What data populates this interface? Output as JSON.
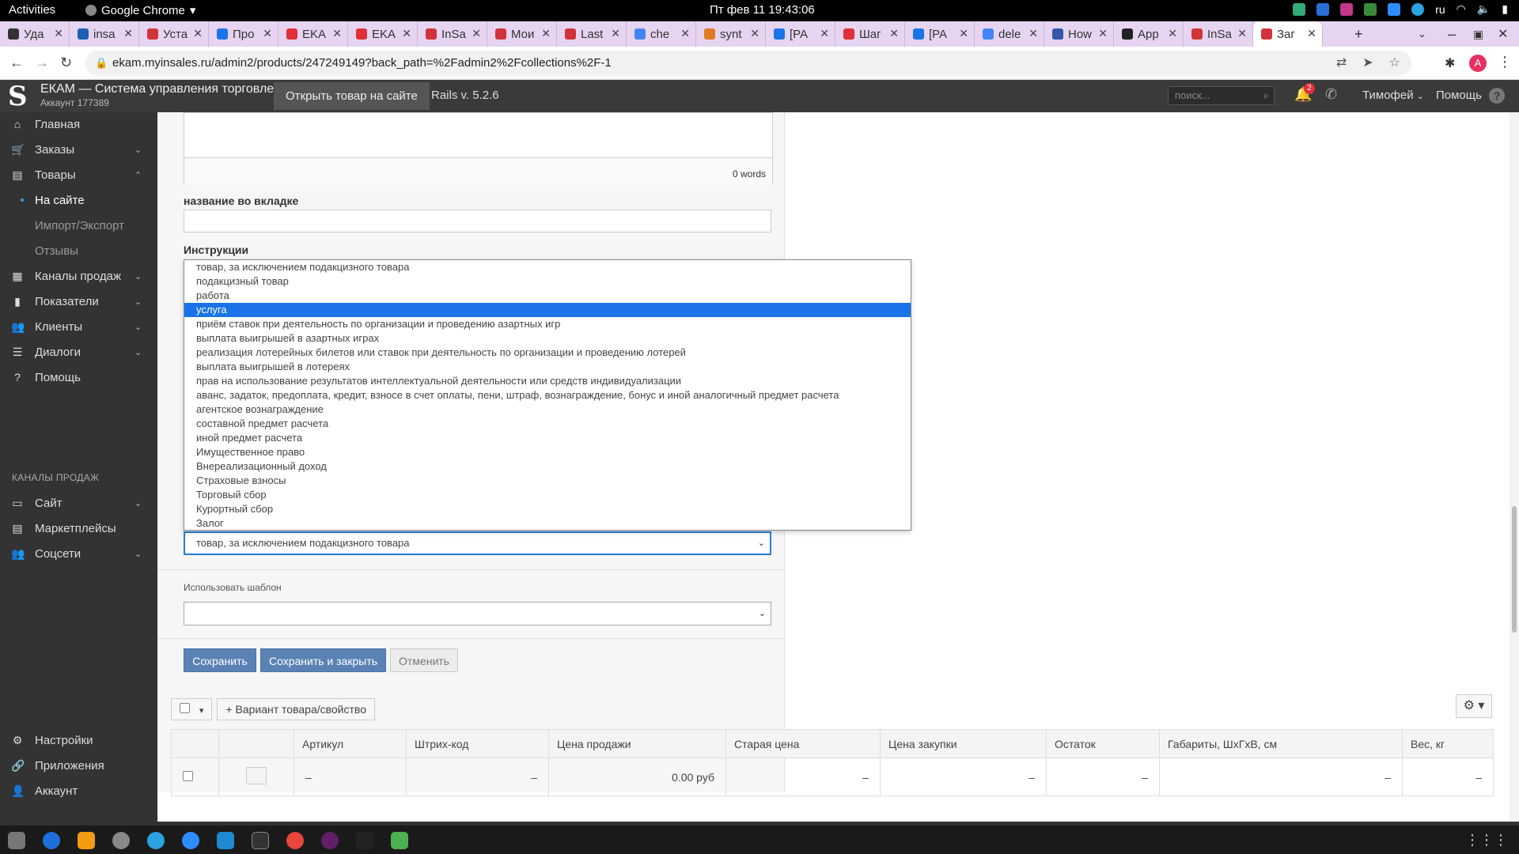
{
  "system_bar": {
    "activities": "Activities",
    "app_name": "Google Chrome",
    "clock": "Пт фев 11  19:43:06",
    "lang": "ru"
  },
  "tabs": [
    {
      "label": "Уда",
      "color": "#333333"
    },
    {
      "label": "insa",
      "color": "#1a5fb4"
    },
    {
      "label": "Уста",
      "color": "#d0333a"
    },
    {
      "label": "Про",
      "color": "#1a73e8"
    },
    {
      "label": "EKA",
      "color": "#e0303a"
    },
    {
      "label": "EKA",
      "color": "#e0303a"
    },
    {
      "label": "InSa",
      "color": "#d0333a"
    },
    {
      "label": "Мои",
      "color": "#d0333a"
    },
    {
      "label": "Last",
      "color": "#d0333a"
    },
    {
      "label": "che",
      "color": "#4285f4"
    },
    {
      "label": "synt",
      "color": "#e07a20"
    },
    {
      "label": "[PA",
      "color": "#1a73e8"
    },
    {
      "label": "Шаг",
      "color": "#e0303a"
    },
    {
      "label": "[PA",
      "color": "#1a73e8"
    },
    {
      "label": "dele",
      "color": "#4285f4"
    },
    {
      "label": "How",
      "color": "#3355aa"
    },
    {
      "label": "App",
      "color": "#222222"
    },
    {
      "label": "InSa",
      "color": "#d0333a"
    },
    {
      "label": "Заг",
      "color": "#d0333a",
      "active": true
    }
  ],
  "address": {
    "url": "ekam.myinsales.ru/admin2/products/247249149?back_path=%2Fadmin2%2Fcollections%2F-1",
    "avatar_letter": "A"
  },
  "header": {
    "logo": "S",
    "brand": "ЕКАМ — Система управления торговлей",
    "account": "Аккаунт 177389",
    "open_button": "Открыть товар на сайте",
    "rails": "Rails v. 5.2.6",
    "search_placeholder": "поиск...",
    "notifications": "2",
    "user": "Тимофей",
    "help": "Помощь"
  },
  "sidebar": {
    "items": [
      {
        "label": "Главная",
        "icon": "home-icon"
      },
      {
        "label": "Заказы",
        "icon": "cart-icon"
      },
      {
        "label": "Товары",
        "icon": "products-icon"
      },
      {
        "label": "На сайте"
      },
      {
        "label": "Импорт/Экспорт"
      },
      {
        "label": "Отзывы"
      },
      {
        "label": "Каналы продаж",
        "icon": "channels-icon"
      },
      {
        "label": "Показатели",
        "icon": "chart-icon"
      },
      {
        "label": "Клиенты",
        "icon": "clients-icon"
      },
      {
        "label": "Диалоги",
        "icon": "dialogs-icon"
      },
      {
        "label": "Помощь",
        "icon": "help-icon"
      }
    ],
    "section_title": "КАНАЛЫ ПРОДАЖ",
    "channels": [
      {
        "label": "Сайт"
      },
      {
        "label": "Маркетплейсы"
      },
      {
        "label": "Соцсети"
      }
    ],
    "bottom": [
      {
        "label": "Настройки"
      },
      {
        "label": "Приложения"
      },
      {
        "label": "Аккаунт"
      }
    ]
  },
  "form": {
    "editor_words": "0 words",
    "tab_name_label": "название во вкладке",
    "instructions_label": "Инструкции",
    "payment_subject_value": "товар, за исключением подакцизного товара",
    "template_label": "Использовать шаблон",
    "template_value": "",
    "save": "Сохранить",
    "save_close": "Сохранить и закрыть",
    "cancel": "Отменить"
  },
  "dropdown": {
    "selected_index": 3,
    "options": [
      "товар, за исключением подакцизного товара",
      "подакцизный товар",
      "работа",
      "услуга",
      "приём ставок при деятельность по организации и проведению азартных игр",
      "выплата выигрышей в азартных играх",
      "реализация лотерейных билетов или ставок при деятельность по организации и проведению лотерей",
      "выплата выигрышей в лотереях",
      "прав на использование результатов интеллектуальной деятельности или средств индивидуализации",
      "аванс, задаток, предоплата, кредит, взносе в счет оплаты, пени, штраф, вознаграждение, бонус и иной аналогичный предмет расчета",
      "агентское вознаграждение",
      "составной предмет расчета",
      "иной предмет расчета",
      "Имущественное право",
      "Внереализационный доход",
      "Страховые взносы",
      "Торговый сбор",
      "Курортный сбор",
      "Залог"
    ]
  },
  "variants": {
    "add_variant": "Вариант товара/свойство",
    "columns": [
      "",
      "",
      "Артикул",
      "Штрих-код",
      "Цена продажи",
      "Старая цена",
      "Цена закупки",
      "Остаток",
      "Габариты, ШхГхВ, см",
      "Вес, кг"
    ],
    "row": {
      "sku": "–",
      "barcode": "–",
      "price": "0.00 руб",
      "old_price": "–",
      "cost": "–",
      "stock": "–",
      "dims": "–",
      "weight": "–"
    }
  }
}
